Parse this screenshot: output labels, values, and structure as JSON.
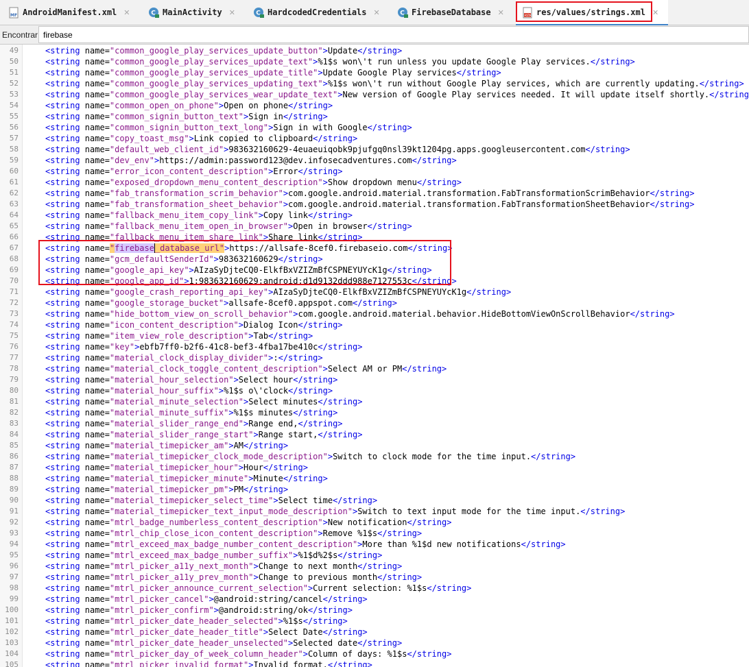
{
  "tabs": [
    {
      "label": "AndroidManifest.xml",
      "icon": "manifest-file-icon",
      "active": false
    },
    {
      "label": "MainActivity",
      "icon": "class-c-icon",
      "active": false
    },
    {
      "label": "HardcodedCredentials",
      "icon": "class-c-icon",
      "active": false
    },
    {
      "label": "FirebaseDatabase",
      "icon": "class-c-icon",
      "active": false
    },
    {
      "label": "res/values/strings.xml",
      "icon": "xml-resource-icon",
      "active": true
    }
  ],
  "find": {
    "label": "Encontrar:",
    "value": "firebase"
  },
  "colors": {
    "tag": "#0000e6",
    "value": "#8b1a8b",
    "highlight_box": "#e5121d",
    "find_match": "#d6c9ff",
    "occurrence": "#ffd27a"
  },
  "lines": [
    {
      "n": "49",
      "name": "common_google_play_services_update_button",
      "value": "Update"
    },
    {
      "n": "50",
      "name": "common_google_play_services_update_text",
      "value": "%1$s won\\'t run unless you update Google Play services."
    },
    {
      "n": "51",
      "name": "common_google_play_services_update_title",
      "value": "Update Google Play services"
    },
    {
      "n": "52",
      "name": "common_google_play_services_updating_text",
      "value": "%1$s won\\'t run without Google Play services, which are currently updating."
    },
    {
      "n": "53",
      "name": "common_google_play_services_wear_update_text",
      "value": "New version of Google Play services needed. It will update itself shortly."
    },
    {
      "n": "54",
      "name": "common_open_on_phone",
      "value": "Open on phone"
    },
    {
      "n": "55",
      "name": "common_signin_button_text",
      "value": "Sign in"
    },
    {
      "n": "56",
      "name": "common_signin_button_text_long",
      "value": "Sign in with Google"
    },
    {
      "n": "57",
      "name": "copy_toast_msg",
      "value": "Link copied to clipboard"
    },
    {
      "n": "58",
      "name": "default_web_client_id",
      "value": "983632160629-4euaeuiqobk9pjufgq0nsl39kt1204pg.apps.googleusercontent.com"
    },
    {
      "n": "59",
      "name": "dev_env",
      "value": "https://admin:password123@dev.infosecadventures.com"
    },
    {
      "n": "60",
      "name": "error_icon_content_description",
      "value": "Error"
    },
    {
      "n": "61",
      "name": "exposed_dropdown_menu_content_description",
      "value": "Show dropdown menu"
    },
    {
      "n": "62",
      "name": "fab_transformation_scrim_behavior",
      "value": "com.google.android.material.transformation.FabTransformationScrimBehavior"
    },
    {
      "n": "63",
      "name": "fab_transformation_sheet_behavior",
      "value": "com.google.android.material.transformation.FabTransformationSheetBehavior"
    },
    {
      "n": "64",
      "name": "fallback_menu_item_copy_link",
      "value": "Copy link"
    },
    {
      "n": "65",
      "name": "fallback_menu_item_open_in_browser",
      "value": "Open in browser"
    },
    {
      "n": "66",
      "name": "fallback_menu_item_share_link",
      "value": "Share link"
    },
    {
      "n": "67",
      "name": "firebase_database_url",
      "value": "https://allsafe-8cef0.firebaseio.com",
      "match": "firebase",
      "rest": "_database_url"
    },
    {
      "n": "68",
      "name": "gcm_defaultSenderId",
      "value": "983632160629"
    },
    {
      "n": "69",
      "name": "google_api_key",
      "value": "AIzaSyDjteCQ0-ElkfBxVZIZmBfCSPNEYUYcK1g"
    },
    {
      "n": "70",
      "name": "google_app_id",
      "value": "1:983632160629:android:d1d9132ddd988e7127553c"
    },
    {
      "n": "71",
      "name": "google_crash_reporting_api_key",
      "value": "AIzaSyDjteCQ0-ElkfBxVZIZmBfCSPNEYUYcK1g"
    },
    {
      "n": "72",
      "name": "google_storage_bucket",
      "value": "allsafe-8cef0.appspot.com"
    },
    {
      "n": "73",
      "name": "hide_bottom_view_on_scroll_behavior",
      "value": "com.google.android.material.behavior.HideBottomViewOnScrollBehavior"
    },
    {
      "n": "74",
      "name": "icon_content_description",
      "value": "Dialog Icon"
    },
    {
      "n": "75",
      "name": "item_view_role_description",
      "value": "Tab"
    },
    {
      "n": "76",
      "name": "key",
      "value": "ebfb7ff0-b2f6-41c8-bef3-4fba17be410c"
    },
    {
      "n": "77",
      "name": "material_clock_display_divider",
      "value": ":"
    },
    {
      "n": "78",
      "name": "material_clock_toggle_content_description",
      "value": "Select AM or PM"
    },
    {
      "n": "79",
      "name": "material_hour_selection",
      "value": "Select hour"
    },
    {
      "n": "80",
      "name": "material_hour_suffix",
      "value": "%1$s o\\'clock"
    },
    {
      "n": "81",
      "name": "material_minute_selection",
      "value": "Select minutes"
    },
    {
      "n": "82",
      "name": "material_minute_suffix",
      "value": "%1$s minutes"
    },
    {
      "n": "83",
      "name": "material_slider_range_end",
      "value": "Range end,"
    },
    {
      "n": "84",
      "name": "material_slider_range_start",
      "value": "Range start,"
    },
    {
      "n": "85",
      "name": "material_timepicker_am",
      "value": "AM"
    },
    {
      "n": "86",
      "name": "material_timepicker_clock_mode_description",
      "value": "Switch to clock mode for the time input."
    },
    {
      "n": "87",
      "name": "material_timepicker_hour",
      "value": "Hour"
    },
    {
      "n": "88",
      "name": "material_timepicker_minute",
      "value": "Minute"
    },
    {
      "n": "89",
      "name": "material_timepicker_pm",
      "value": "PM"
    },
    {
      "n": "90",
      "name": "material_timepicker_select_time",
      "value": "Select time"
    },
    {
      "n": "91",
      "name": "material_timepicker_text_input_mode_description",
      "value": "Switch to text input mode for the time input."
    },
    {
      "n": "92",
      "name": "mtrl_badge_numberless_content_description",
      "value": "New notification"
    },
    {
      "n": "93",
      "name": "mtrl_chip_close_icon_content_description",
      "value": "Remove %1$s"
    },
    {
      "n": "94",
      "name": "mtrl_exceed_max_badge_number_content_description",
      "value": "More than %1$d new notifications"
    },
    {
      "n": "95",
      "name": "mtrl_exceed_max_badge_number_suffix",
      "value": "%1$d%2$s"
    },
    {
      "n": "96",
      "name": "mtrl_picker_a11y_next_month",
      "value": "Change to next month"
    },
    {
      "n": "97",
      "name": "mtrl_picker_a11y_prev_month",
      "value": "Change to previous month"
    },
    {
      "n": "98",
      "name": "mtrl_picker_announce_current_selection",
      "value": "Current selection: %1$s"
    },
    {
      "n": "99",
      "name": "mtrl_picker_cancel",
      "value": "@android:string/cancel"
    },
    {
      "n": "100",
      "name": "mtrl_picker_confirm",
      "value": "@android:string/ok"
    },
    {
      "n": "101",
      "name": "mtrl_picker_date_header_selected",
      "value": "%1$s"
    },
    {
      "n": "102",
      "name": "mtrl_picker_date_header_title",
      "value": "Select Date"
    },
    {
      "n": "103",
      "name": "mtrl_picker_date_header_unselected",
      "value": "Selected date"
    },
    {
      "n": "104",
      "name": "mtrl_picker_day_of_week_column_header",
      "value": "Column of days: %1$s"
    },
    {
      "n": "105",
      "name": "mtrl_picker_invalid_format",
      "value": "Invalid format."
    }
  ]
}
